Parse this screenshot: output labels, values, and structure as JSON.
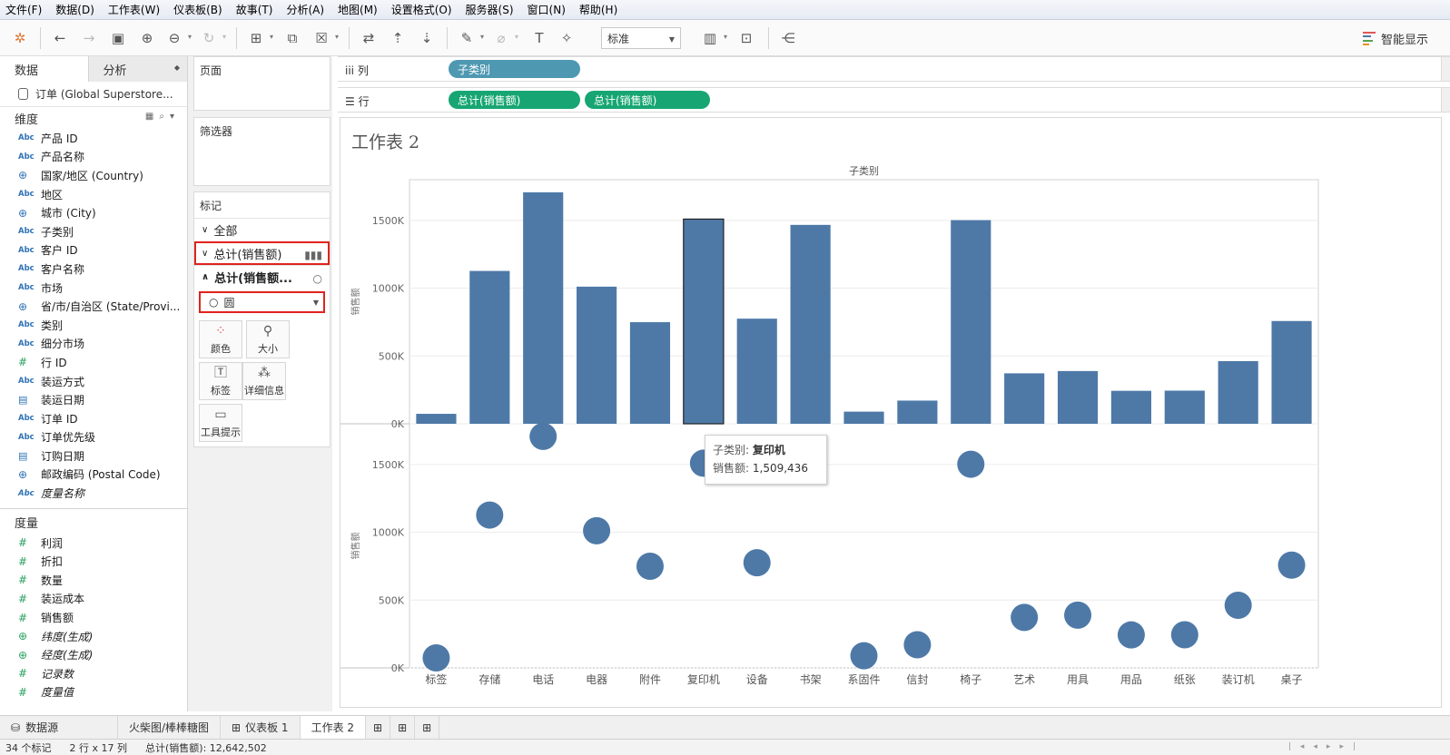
{
  "menu": [
    "文件(F)",
    "数据(D)",
    "工作表(W)",
    "仪表板(B)",
    "故事(T)",
    "分析(A)",
    "地图(M)",
    "设置格式(O)",
    "服务器(S)",
    "窗口(N)",
    "帮助(H)"
  ],
  "toolbar": {
    "mark_size_select": "标准",
    "smart_show": "智能显示"
  },
  "left_panel": {
    "tab_data": "数据",
    "tab_analysis": "分析",
    "datasource": "订单 (Global Superstore...",
    "dimensions_title": "维度",
    "dimensions": [
      {
        "icon": "abc",
        "label": "产品 ID"
      },
      {
        "icon": "abc",
        "label": "产品名称"
      },
      {
        "icon": "geo",
        "label": "国家/地区 (Country)"
      },
      {
        "icon": "abc",
        "label": "地区"
      },
      {
        "icon": "geo",
        "label": "城市 (City)"
      },
      {
        "icon": "abc",
        "label": "子类别"
      },
      {
        "icon": "abc",
        "label": "客户 ID"
      },
      {
        "icon": "abc",
        "label": "客户名称"
      },
      {
        "icon": "abc",
        "label": "市场"
      },
      {
        "icon": "geo",
        "label": "省/市/自治区 (State/Provi..."
      },
      {
        "icon": "abc",
        "label": "类别"
      },
      {
        "icon": "abc",
        "label": "细分市场"
      },
      {
        "icon": "num",
        "label": "行 ID"
      },
      {
        "icon": "abc",
        "label": "装运方式"
      },
      {
        "icon": "date",
        "label": "装运日期"
      },
      {
        "icon": "abc",
        "label": "订单 ID"
      },
      {
        "icon": "abc",
        "label": "订单优先级"
      },
      {
        "icon": "date",
        "label": "订购日期"
      },
      {
        "icon": "geo",
        "label": "邮政编码 (Postal Code)"
      },
      {
        "icon": "abc",
        "label": "度量名称",
        "italic": true
      }
    ],
    "measures_title": "度量",
    "measures": [
      {
        "icon": "num",
        "label": "利润"
      },
      {
        "icon": "num",
        "label": "折扣"
      },
      {
        "icon": "num",
        "label": "数量"
      },
      {
        "icon": "num",
        "label": "装运成本"
      },
      {
        "icon": "num",
        "label": "销售额"
      },
      {
        "icon": "geonum",
        "label": "纬度(生成)",
        "italic": true
      },
      {
        "icon": "geonum",
        "label": "经度(生成)",
        "italic": true
      },
      {
        "icon": "num",
        "label": "记录数",
        "italic": true
      },
      {
        "icon": "num",
        "label": "度量值",
        "italic": true
      }
    ]
  },
  "mid_panel": {
    "pages_title": "页面",
    "filters_title": "筛选器",
    "marks_title": "标记",
    "marks_all": "全部",
    "marks_row1": "总计(销售额)",
    "marks_row2": "总计(销售额...",
    "mark_type": "圆",
    "buttons": [
      "颜色",
      "大小",
      "标签",
      "详细信息",
      "工具提示"
    ]
  },
  "shelves": {
    "columns_label": "列",
    "rows_label": "行",
    "column_pills": [
      "子类别"
    ],
    "row_pills": [
      "总计(销售额)",
      "总计(销售额)"
    ]
  },
  "sheet_title": "工作表 2",
  "tooltip": {
    "k1": "子类别:",
    "v1": "复印机",
    "k2": "销售额:",
    "v2": "1,509,436"
  },
  "tabs": {
    "datasource": "数据源",
    "tab1": "火柴图/棒棒糖图",
    "tab2": "仪表板 1",
    "tab3": "工作表 2"
  },
  "status": {
    "marks": "34 个标记",
    "dims": "2 行 x 17 列",
    "sum": "总计(销售额): 12,642,502"
  },
  "chart_data": {
    "type": "bar",
    "header": "子类别",
    "categories": [
      "标签",
      "存储",
      "电话",
      "电器",
      "附件",
      "复印机",
      "设备",
      "书架",
      "系固件",
      "信封",
      "椅子",
      "艺术",
      "用具",
      "用品",
      "纸张",
      "装订机",
      "桌子"
    ],
    "series": [
      {
        "mark": "bar",
        "ylabel": "销售额",
        "values": [
          73400,
          1127000,
          1706800,
          1011100,
          749200,
          1509436,
          775100,
          1466600,
          89500,
          170900,
          1501700,
          372100,
          388800,
          243000,
          244300,
          462000,
          757700
        ]
      },
      {
        "mark": "circle",
        "ylabel": "销售额",
        "values": [
          73400,
          1127000,
          1706800,
          1011100,
          749200,
          1509436,
          775100,
          1466600,
          89500,
          170900,
          1501700,
          372100,
          388800,
          243000,
          244300,
          462000,
          757700
        ]
      }
    ],
    "yticks": [
      0,
      500000,
      1000000,
      1500000
    ],
    "ytick_labels": [
      "0K",
      "500K",
      "1000K",
      "1500K"
    ],
    "ylim": [
      0,
      1800000
    ],
    "highlight": "复印机",
    "colors": {
      "mark": "#4e79a7",
      "grid": "#ececec"
    }
  }
}
